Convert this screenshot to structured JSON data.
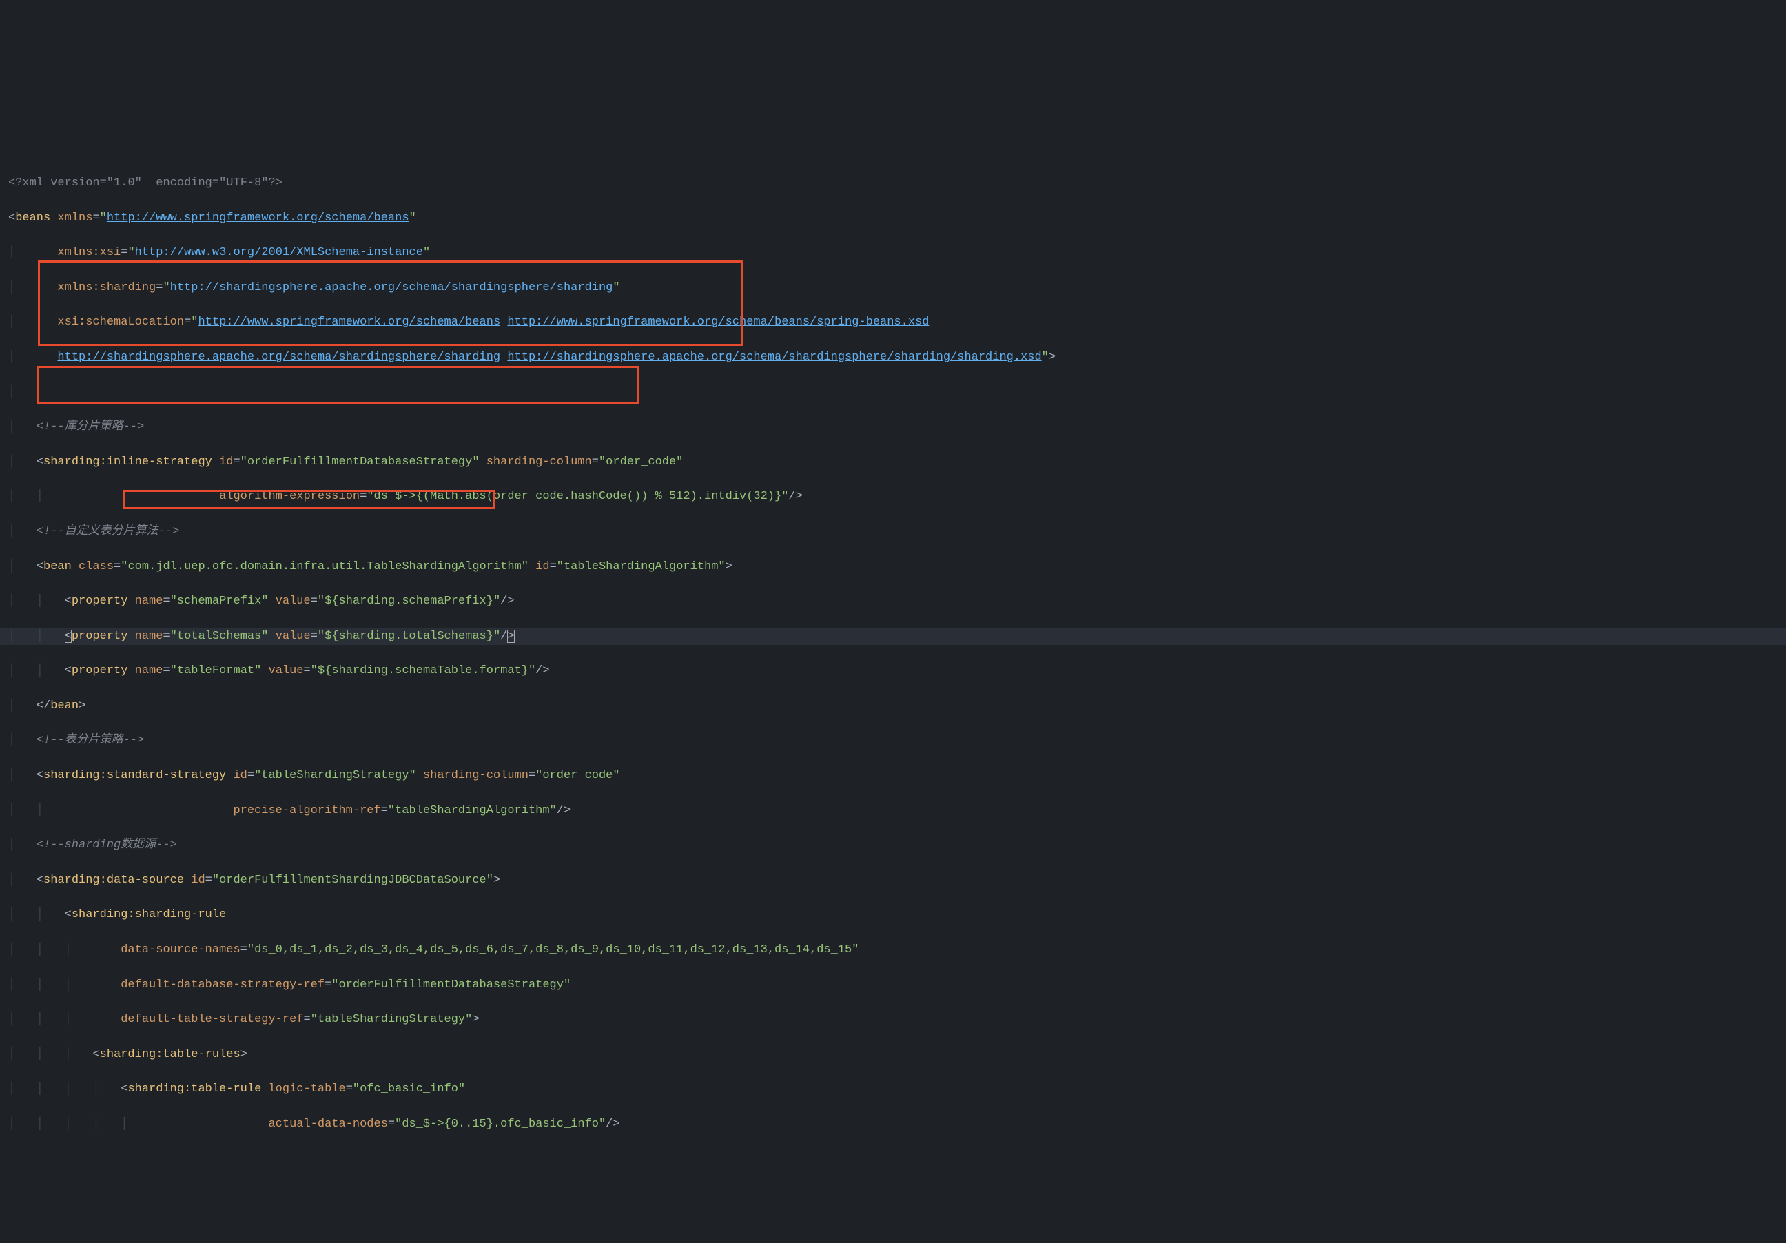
{
  "lines": {
    "l1_a": "<?xml ",
    "l1_attr1": "version",
    "l1_v1": "\"1.0\"",
    "l1_attr2": "encoding",
    "l1_v2": "\"UTF-8\"",
    "l1_b": "?>",
    "l2_tag": "beans",
    "l2_attr": "xmlns",
    "l2_url": "http://www.springframework.org/schema/beans",
    "l3_attr": "xmlns:xsi",
    "l3_url": "http://www.w3.org/2001/XMLSchema-instance",
    "l4_attr": "xmlns:sharding",
    "l4_url": "http://shardingsphere.apache.org/schema/shardingsphere/sharding",
    "l5_attr": "xsi:schemaLocation",
    "l5_url1": "http://www.springframework.org/schema/beans",
    "l5_url2": "http://www.springframework.org/schema/beans/spring-beans.xsd",
    "l6_url1": "http://shardingsphere.apache.org/schema/shardingsphere/sharding",
    "l6_url2": "http://shardingsphere.apache.org/schema/shardingsphere/sharding/sharding.xsd",
    "c1": "<!--库分片策略-->",
    "l8_tag": "sharding:inline-strategy",
    "l8_attr1": "id",
    "l8_v1": "\"orderFulfillmentDatabaseStrategy\"",
    "l8_attr2": "sharding-column",
    "l8_v2": "\"order_code\"",
    "l9_attr": "algorithm-expression",
    "l9_v": "\"ds_$->{(Math.abs(order_code.hashCode()) % 512).intdiv(32)}\"",
    "c2": "<!--自定义表分片算法-->",
    "l11_tag": "bean",
    "l11_attr1": "class",
    "l11_v1": "\"com.jdl.uep.ofc.domain.infra.util.TableShardingAlgorithm\"",
    "l11_attr2": "id",
    "l11_v2": "\"tableShardingAlgorithm\"",
    "l12_tag": "property",
    "l12_attr1": "name",
    "l12_v1": "\"schemaPrefix\"",
    "l12_attr2": "value",
    "l12_v2": "\"${sharding.schemaPrefix}\"",
    "l13_v1": "\"totalSchemas\"",
    "l13_v2": "\"${sharding.totalSchemas}\"",
    "l14_v1": "\"tableFormat\"",
    "l14_v2": "\"${sharding.schemaTable.format}\"",
    "l15_close": "bean",
    "c3": "<!--表分片策略-->",
    "l17_tag": "sharding:standard-strategy",
    "l17_attr1": "id",
    "l17_v1": "\"tableShardingStrategy\"",
    "l17_attr2": "sharding-column",
    "l17_v2": "\"order_code\"",
    "l18_attr": "precise-algorithm-ref",
    "l18_v": "\"tableShardingAlgorithm\"",
    "c4": "<!--sharding数据源-->",
    "l20_tag": "sharding:data-source",
    "l20_attr": "id",
    "l20_v": "\"orderFulfillmentShardingJDBCDataSource\"",
    "l21_tag": "sharding:sharding-rule",
    "l22_attr": "data-source-names",
    "l22_v": "\"ds_0,ds_1,ds_2,ds_3,ds_4,ds_5,ds_6,ds_7,ds_8,ds_9,ds_10,ds_11,ds_12,ds_13,ds_14,ds_15\"",
    "l23_attr": "default-database-strategy-ref",
    "l23_v": "\"orderFulfillmentDatabaseStrategy\"",
    "l24_attr": "default-table-strategy-ref",
    "l24_v": "\"tableShardingStrategy\"",
    "l25_tag": "sharding:table-rules",
    "l26_tag": "sharding:table-rule",
    "l26_attr": "logic-table",
    "l26_v": "\"ofc_basic_info\"",
    "l27_attr": "actual-data-nodes",
    "l27_v": "\"ds_$->{0..15}.ofc_basic_info\""
  }
}
